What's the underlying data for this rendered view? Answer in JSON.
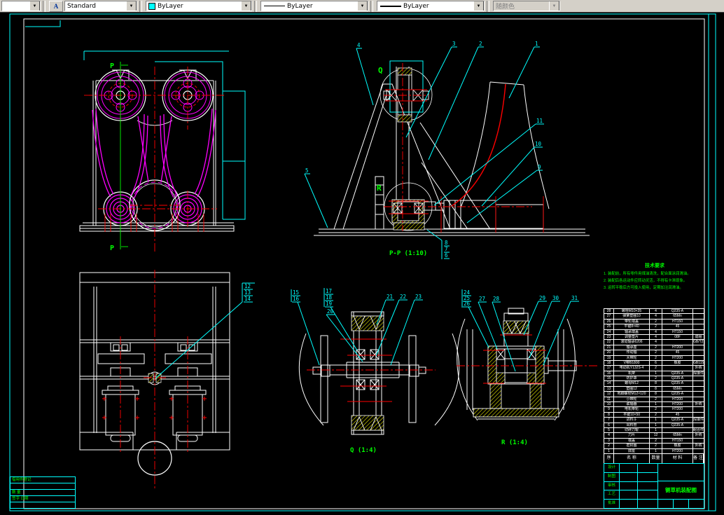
{
  "toolbar": {
    "style_value": "Standard",
    "color_value": "ByLayer",
    "linetype_value": "ByLayer",
    "lineweight_value": "ByLayer",
    "plotstyle_value": "随颜色"
  },
  "icons": {
    "dropdown": "▼",
    "text_style": "A"
  },
  "labels": {
    "p_top": "P",
    "p_bottom": "P",
    "q": "Q",
    "r": "R",
    "view_pp": "P-P (1:10)",
    "view_q": "Q (1:4)",
    "view_r": "R (1:4)"
  },
  "callouts": {
    "pp": [
      "4",
      "3",
      "2",
      "1",
      "5",
      "11",
      "10",
      "9",
      "8",
      "7",
      "6"
    ],
    "tv": [
      "12",
      "13",
      "14"
    ],
    "q": [
      "15",
      "16",
      "17",
      "18",
      "19",
      "20",
      "21",
      "22",
      "23"
    ],
    "r": [
      "24",
      "25",
      "26",
      "27",
      "28",
      "29",
      "30",
      "31"
    ]
  },
  "notes": {
    "title": "技术要求",
    "lines": [
      "1. 装配前，所有零件用煤油清洗，配合面涂润滑油。",
      "2. 装配后各运动件应转动灵活，不得有卡滞现象。",
      "3. 运转平稳后方可投入使用，定期加注润滑油。"
    ]
  },
  "bom": {
    "headers": [
      "序 号",
      "名    称",
      "数量",
      "材  料",
      "备 注"
    ],
    "rows": [
      [
        "28",
        "螺栓M10×35",
        "4",
        "Q235-A",
        ""
      ],
      [
        "27",
        "弹簧垫圈10",
        "4",
        "65Mn",
        ""
      ],
      [
        "26",
        "带轮端盖",
        "2",
        "HT150",
        ""
      ],
      [
        "25",
        "平键8×40",
        "2",
        "45",
        ""
      ],
      [
        "24",
        "轴承端盖",
        "4",
        "HT150",
        ""
      ],
      [
        "23",
        "调整垫片",
        "4",
        "08F",
        "成组"
      ],
      [
        "22",
        "滚动轴承6206",
        "4",
        "",
        "GB/T276"
      ],
      [
        "21",
        "轴承座",
        "2",
        "HT200",
        ""
      ],
      [
        "20",
        "传动轴",
        "2",
        "45",
        ""
      ],
      [
        "19",
        "大带轮",
        "2",
        "HT200",
        ""
      ],
      [
        "18",
        "V带B1800",
        "6",
        "橡胶",
        "GB11544"
      ],
      [
        "17",
        "电动机Y132S-4",
        "2",
        "",
        "外购"
      ],
      [
        "16",
        "机架",
        "1",
        "Q235-A",
        "焊接件"
      ],
      [
        "15",
        "防护罩",
        "2",
        "Q235-A",
        ""
      ],
      [
        "14",
        "螺母M12",
        "8",
        "Q235-A",
        ""
      ],
      [
        "13",
        "垫圈12",
        "8",
        "65Mn",
        ""
      ],
      [
        "12",
        "地脚螺栓M12×120",
        "8",
        "Q235-A",
        ""
      ],
      [
        "11",
        "小带轮",
        "2",
        "HT200",
        ""
      ],
      [
        "10",
        "联轴器",
        "1",
        "HT200",
        "外购"
      ],
      [
        "9",
        "电机带轮",
        "2",
        "HT200",
        ""
      ],
      [
        "8",
        "平键10×50",
        "2",
        "45",
        ""
      ],
      [
        "7",
        "进料斗",
        "1",
        "Q235-A",
        "焊接件"
      ],
      [
        "6",
        "出料管",
        "1",
        "Q235-A",
        ""
      ],
      [
        "5",
        "切碎刀辊",
        "1",
        "",
        "组合件"
      ],
      [
        "4",
        "刀片",
        "12",
        "65Mn",
        "外购"
      ],
      [
        "3",
        "端盖",
        "2",
        "HT150",
        ""
      ],
      [
        "2",
        "密封圈",
        "2",
        "橡胶",
        "外购"
      ],
      [
        "1",
        "底座",
        "1",
        "HT200",
        ""
      ]
    ]
  },
  "titleblock": {
    "left_labels": [
      "设计",
      "制图",
      "审核",
      "工艺",
      "批准"
    ],
    "title": "铡草机装配图"
  },
  "minitable": {
    "rows": [
      "借用件登记",
      "数 量",
      "签字 日期"
    ]
  },
  "colors": {
    "cyan": "#00ffff",
    "red": "#ff0000",
    "magenta": "#ff00ff",
    "green": "#00ff00",
    "yellow": "#ffff00",
    "white": "#ffffff"
  }
}
